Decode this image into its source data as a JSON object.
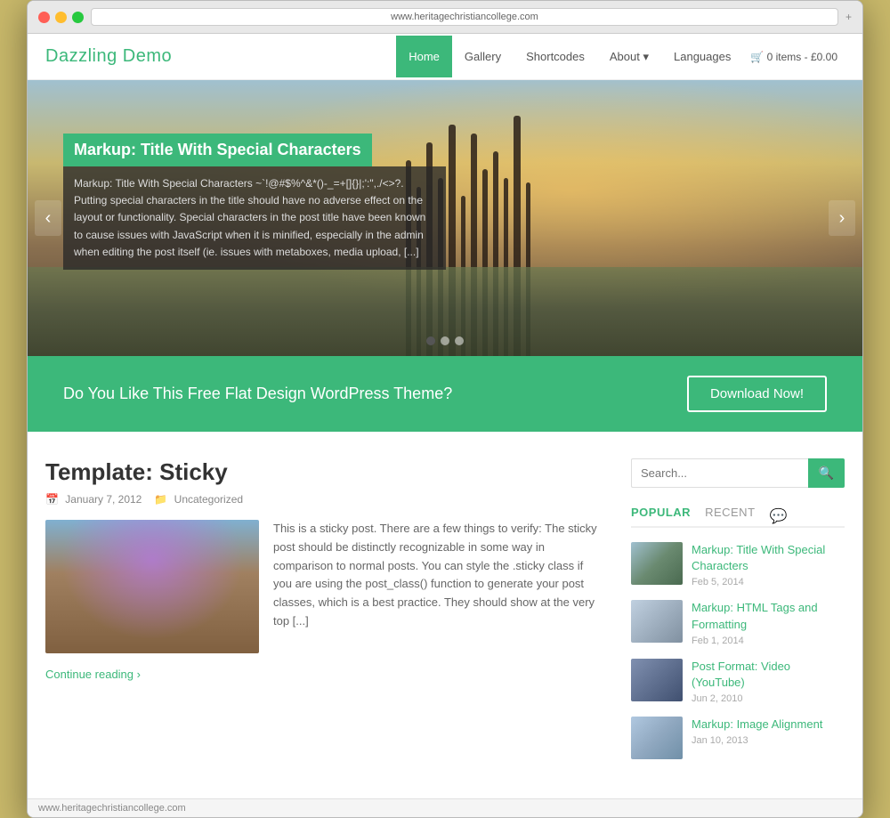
{
  "browser": {
    "address": "www.heritagechristiancollege.com"
  },
  "header": {
    "logo": "Dazzling Demo",
    "nav": [
      {
        "label": "Home",
        "active": true
      },
      {
        "label": "Gallery",
        "active": false
      },
      {
        "label": "Shortcodes",
        "active": false
      },
      {
        "label": "About ▾",
        "active": false
      },
      {
        "label": "Languages",
        "active": false
      }
    ],
    "cart": "🛒 0 items - £0.00"
  },
  "slider": {
    "title": "Markup: Title With Special Characters",
    "text": "Markup: Title With Special Characters ~`!@#$%^&*()-_=+[]{}|;':\",./<>?. Putting special characters in the title should have no adverse effect on the layout or functionality. Special characters in the post title have been known to cause issues with JavaScript when it is minified, especially in the admin when editing the post itself (ie. issues with metaboxes, media upload, [...]",
    "prev_label": "‹",
    "next_label": "›",
    "dots": [
      {
        "active": true
      },
      {
        "active": false
      },
      {
        "active": false
      }
    ]
  },
  "cta": {
    "text": "Do You Like This Free Flat Design WordPress Theme?",
    "button_label": "Download Now!"
  },
  "post": {
    "title": "Template: Sticky",
    "date": "January 7, 2012",
    "category": "Uncategorized",
    "excerpt": "This is a sticky post. There are a few things to verify: The sticky post should be distinctly recognizable in some way in comparison to normal posts. You can style the .sticky class if you are using the post_class() function to generate your post classes, which is a best practice. They should show at the very top [...]",
    "continue_label": "Continue reading ›"
  },
  "sidebar": {
    "search_placeholder": "Search...",
    "search_btn_icon": "🔍",
    "tabs": [
      {
        "label": "POPULAR",
        "active": true
      },
      {
        "label": "RECENT",
        "active": false
      }
    ],
    "comment_icon": "💬",
    "posts": [
      {
        "title": "Markup: Title With Special Characters",
        "date": "Feb 5, 2014",
        "thumb_class": "thumb-1"
      },
      {
        "title": "Markup: HTML Tags and Formatting",
        "date": "Feb 1, 2014",
        "thumb_class": "thumb-2"
      },
      {
        "title": "Post Format: Video (YouTube)",
        "date": "Jun 2, 2010",
        "thumb_class": "thumb-3"
      },
      {
        "title": "Markup: Image Alignment",
        "date": "Jan 10, 2013",
        "thumb_class": "thumb-4"
      }
    ]
  }
}
